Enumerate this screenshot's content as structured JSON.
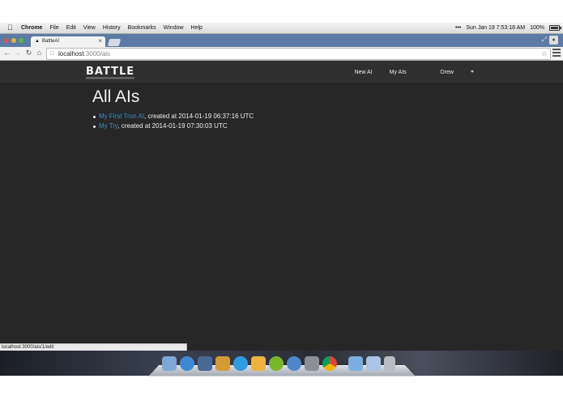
{
  "menubar": {
    "app_name": "Chrome",
    "menus": [
      "File",
      "Edit",
      "View",
      "History",
      "Bookmarks",
      "Window",
      "Help"
    ],
    "clock": "Sun Jan 19  7:53:18 AM",
    "battery": "100%",
    "extras": "•••"
  },
  "browser": {
    "tab_title": "BattleAI",
    "tab_close": "×",
    "url_host": "localhost",
    "url_path": ":3000/ais",
    "status_url": "localhost:3000/ais/1/edit"
  },
  "site": {
    "logo": "BATTLE",
    "nav": {
      "new_ai": "New AI",
      "my_ais": "My AIs",
      "user": "Drew"
    },
    "heading": "All AIs",
    "ais": [
      {
        "name": "My First Tron AI",
        "suffix": ", created at 2014-01-19 06:37:16 UTC"
      },
      {
        "name": "My Try",
        "suffix": ", created at 2014-01-19 07:30:03 UTC"
      }
    ]
  },
  "colors": {
    "link": "#3d8fc4",
    "site_bg": "#272727",
    "navbar_bg": "#2f2f2f",
    "tabstrip": "#5b7ba6"
  },
  "dock_icons": [
    "finder-icon",
    "safari-icon",
    "app-icon",
    "app-icon",
    "itunes-icon",
    "stickies-icon",
    "spotify-icon",
    "info-icon",
    "preview-icon",
    "chrome-icon",
    "folder-icon",
    "downloads-icon",
    "trash-icon"
  ]
}
